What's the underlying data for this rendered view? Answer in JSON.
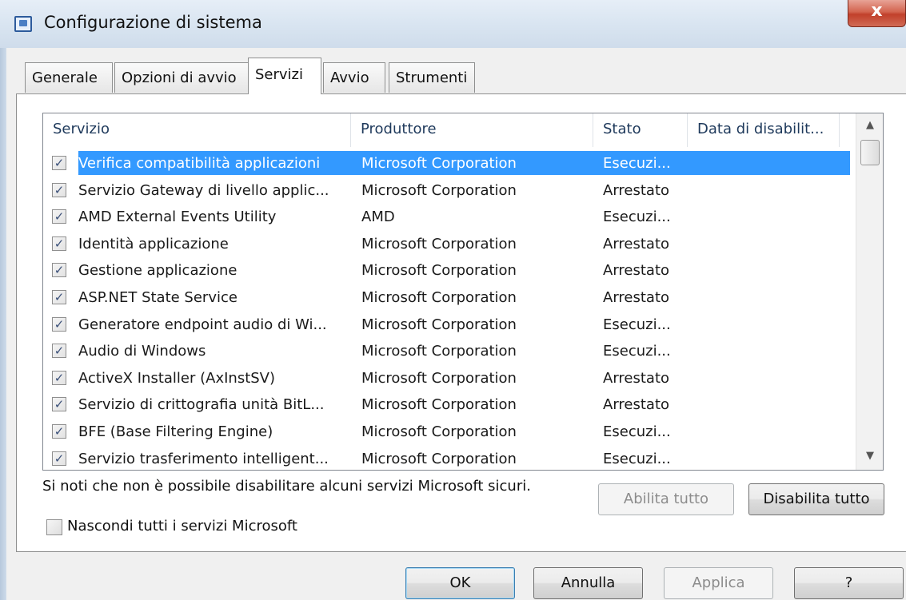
{
  "window": {
    "title": "Configurazione di sistema",
    "close_label": "x"
  },
  "tabs": [
    {
      "label": "Generale",
      "active": false
    },
    {
      "label": "Opzioni di avvio",
      "active": false
    },
    {
      "label": "Servizi",
      "active": true
    },
    {
      "label": "Avvio",
      "active": false
    },
    {
      "label": "Strumenti",
      "active": false
    }
  ],
  "list": {
    "columns": [
      "Servizio",
      "Produttore",
      "Stato",
      "Data di disabilit..."
    ],
    "rows": [
      {
        "name": "Verifica compatibilità applicazioni",
        "manufacturer": "Microsoft Corporation",
        "status": "Esecuzi...",
        "date": "",
        "checked": true,
        "selected": true
      },
      {
        "name": "Servizio Gateway di livello applic...",
        "manufacturer": "Microsoft Corporation",
        "status": "Arrestato",
        "date": "",
        "checked": true,
        "selected": false
      },
      {
        "name": "AMD External Events Utility",
        "manufacturer": "AMD",
        "status": "Esecuzi...",
        "date": "",
        "checked": true,
        "selected": false
      },
      {
        "name": "Identità applicazione",
        "manufacturer": "Microsoft Corporation",
        "status": "Arrestato",
        "date": "",
        "checked": true,
        "selected": false
      },
      {
        "name": "Gestione applicazione",
        "manufacturer": "Microsoft Corporation",
        "status": "Arrestato",
        "date": "",
        "checked": true,
        "selected": false
      },
      {
        "name": "ASP.NET State Service",
        "manufacturer": "Microsoft Corporation",
        "status": "Arrestato",
        "date": "",
        "checked": true,
        "selected": false
      },
      {
        "name": "Generatore endpoint audio di Wi...",
        "manufacturer": "Microsoft Corporation",
        "status": "Esecuzi...",
        "date": "",
        "checked": true,
        "selected": false
      },
      {
        "name": "Audio di Windows",
        "manufacturer": "Microsoft Corporation",
        "status": "Esecuzi...",
        "date": "",
        "checked": true,
        "selected": false
      },
      {
        "name": "ActiveX Installer (AxInstSV)",
        "manufacturer": "Microsoft Corporation",
        "status": "Arrestato",
        "date": "",
        "checked": true,
        "selected": false
      },
      {
        "name": "Servizio di crittografia unità BitL...",
        "manufacturer": "Microsoft Corporation",
        "status": "Arrestato",
        "date": "",
        "checked": true,
        "selected": false
      },
      {
        "name": "BFE (Base Filtering Engine)",
        "manufacturer": "Microsoft Corporation",
        "status": "Esecuzi...",
        "date": "",
        "checked": true,
        "selected": false
      },
      {
        "name": "Servizio trasferimento intelligent...",
        "manufacturer": "Microsoft Corporation",
        "status": "Esecuzi...",
        "date": "",
        "checked": true,
        "selected": false
      }
    ]
  },
  "note": "Si noti che non è possibile disabilitare alcuni servizi Microsoft sicuri.",
  "buttons": {
    "enable_all": "Abilita tutto",
    "disable_all": "Disabilita tutto",
    "ok": "OK",
    "cancel": "Annulla",
    "apply": "Applica",
    "help": "?"
  },
  "hide_ms_label": "Nascondi tutti i servizi Microsoft",
  "hide_ms_checked": false,
  "check_glyph": "✓"
}
